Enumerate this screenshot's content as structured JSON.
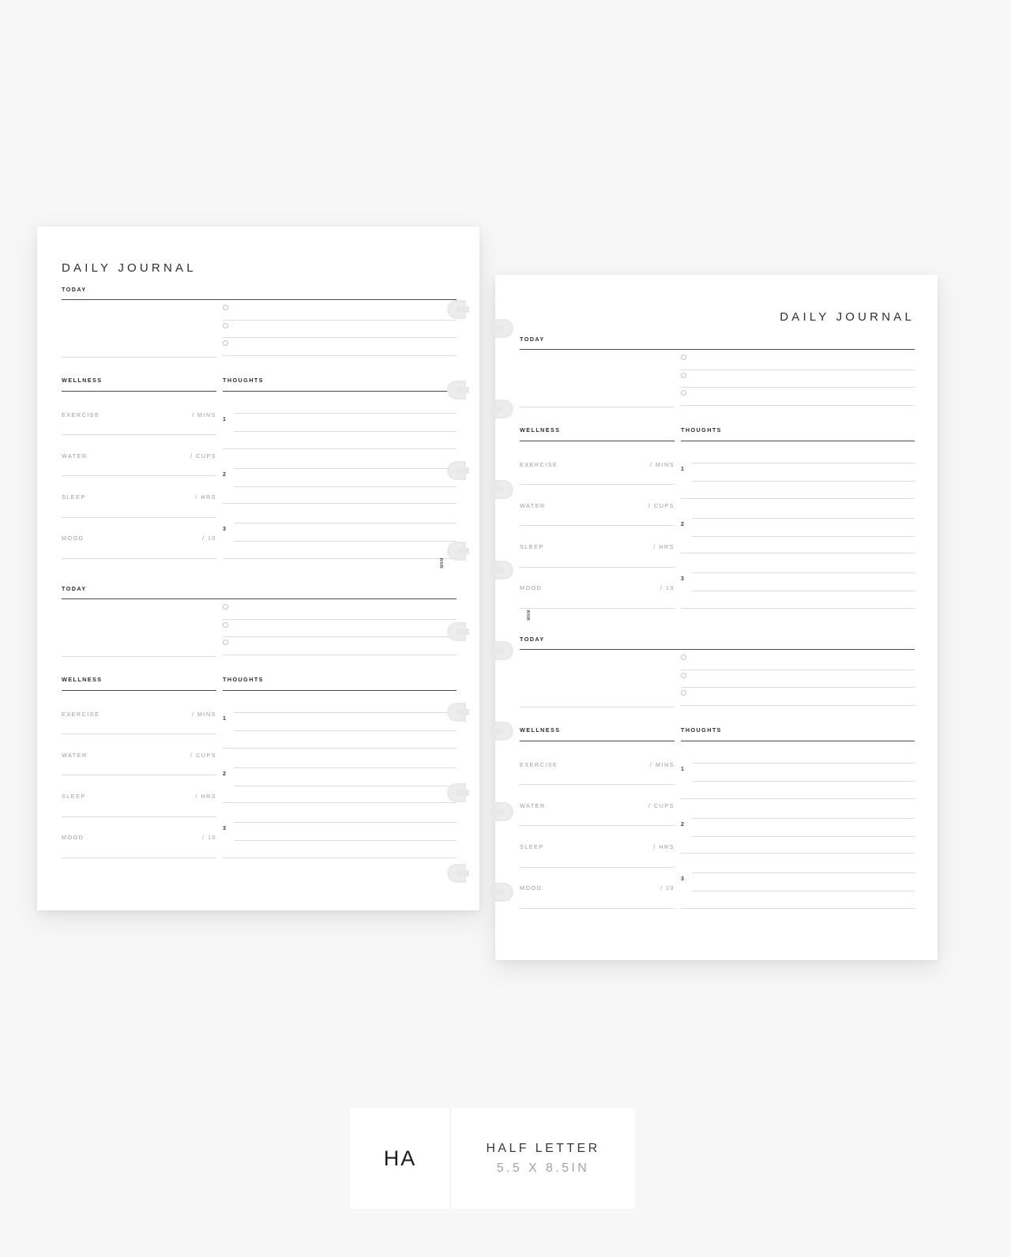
{
  "product": {
    "title": "DAILY JOURNAL",
    "brand_mark": "MNM"
  },
  "labels": {
    "today": "TODAY",
    "wellness": "WELLNESS",
    "thoughts": "THOUGHTS"
  },
  "wellness_metrics": [
    {
      "name": "EXERCISE",
      "unit": "/ MINS"
    },
    {
      "name": "WATER",
      "unit": "/ CUPS"
    },
    {
      "name": "SLEEP",
      "unit": "/ HRS"
    },
    {
      "name": "MOOD",
      "unit": "/ 10"
    }
  ],
  "thought_numbers": [
    "1",
    "2",
    "3"
  ],
  "todo_count": 3,
  "badges": {
    "logo": "HA",
    "size_title": "HALF LETTER",
    "size_sub": "5.5 X 8.5IN"
  },
  "colors": {
    "background": "#f7f7f7",
    "page": "#ffffff",
    "ink": "#2b2b2b",
    "muted": "#9b9b9b",
    "rule_dark": "#4a4a4a",
    "rule_mid": "#b9b9b9",
    "rule_light": "#dcdcdc",
    "disc": "#ededed"
  }
}
